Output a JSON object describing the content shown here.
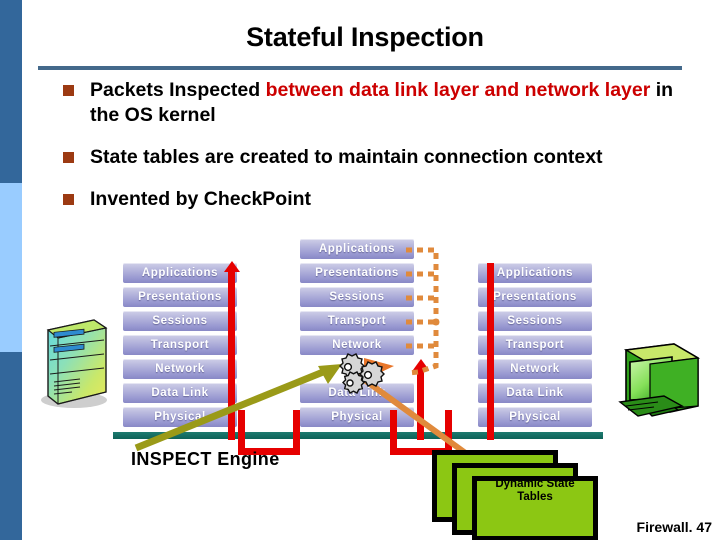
{
  "slide": {
    "title": "Stateful Inspection",
    "footer": "Firewall. 47"
  },
  "bullets": [
    {
      "plain_before": "Packets Inspected ",
      "highlight": "between data link layer and network layer",
      "plain_after": " in the OS kernel",
      "full_text": "Packets Inspected between data link layer and network layer in the OS kernel"
    },
    {
      "plain_before": "State tables are created to maintain connection context",
      "highlight": "",
      "plain_after": "",
      "full_text": "State tables are created to maintain connection context"
    },
    {
      "plain_before": "Invented by CheckPoint",
      "highlight": "",
      "plain_after": "",
      "full_text": "Invented by CheckPoint"
    }
  ],
  "diagram": {
    "inspect_engine_label": "INSPECT Engine",
    "dynamic_state_tables_label": "Dynamic State Tables",
    "columns": [
      {
        "name": "left-host-stack",
        "layers": [
          "Applications",
          "Presentations",
          "Sessions",
          "Transport",
          "Network",
          "Data Link",
          "Physical"
        ]
      },
      {
        "name": "firewall-stack",
        "layers": [
          "Applications",
          "Presentations",
          "Sessions",
          "Transport",
          "Network",
          "Data Link",
          "Physical"
        ]
      },
      {
        "name": "right-host-stack",
        "layers": [
          "Applications",
          "Presentations",
          "Sessions",
          "Transport",
          "Network",
          "Data Link",
          "Physical"
        ]
      }
    ],
    "icons": {
      "left": "server-tower-icon",
      "right": "desktop-computer-icon",
      "center": "gears-icon"
    }
  },
  "colors": {
    "rail_dark": "#33679B",
    "rail_light": "#99CCFF",
    "title_rule": "#44698B",
    "bullet_marker": "#9C3A12",
    "highlight_text": "#CC0000",
    "osi_bar_light": "#CFCFE8",
    "osi_bar_dark": "#8888C6",
    "baseline_teal": "#0E6258",
    "arrow_red": "#E60000",
    "arrow_olive": "#9A9A18",
    "arrow_orange": "#E08A3C",
    "dst_green": "#8CC713"
  }
}
